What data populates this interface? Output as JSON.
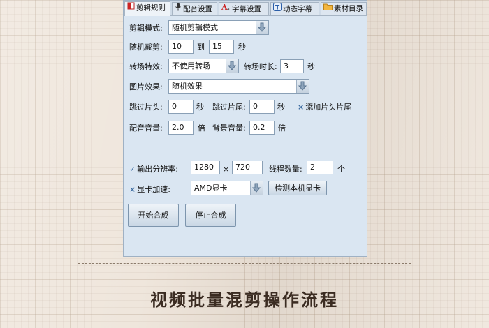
{
  "tabs": [
    {
      "label": "剪辑规则",
      "icon": "red-book-icon"
    },
    {
      "label": "配音设置",
      "icon": "microphone-icon"
    },
    {
      "label": "字幕设置",
      "icon": "text-a-icon"
    },
    {
      "label": "动态字幕",
      "icon": "t-box-icon"
    },
    {
      "label": "素材目录",
      "icon": "folder-icon"
    }
  ],
  "form": {
    "mode_label": "剪辑模式:",
    "mode_value": "随机剪辑模式",
    "random_cut_label": "随机截剪:",
    "random_from": "10",
    "to_label": "到",
    "random_to": "15",
    "sec_label": "秒",
    "transition_label": "转场特效:",
    "transition_value": "不使用转场",
    "transition_dur_label": "转场时长:",
    "transition_dur_value": "3",
    "image_effect_label": "图片效果:",
    "image_effect_value": "随机效果",
    "skip_head_label": "跳过片头:",
    "skip_head_value": "0",
    "skip_tail_label": "跳过片尾:",
    "skip_tail_value": "0",
    "add_head_tail_label": "添加片头片尾",
    "dub_volume_label": "配音音量:",
    "dub_volume_value": "2.0",
    "times_label": "倍",
    "bg_volume_label": "背景音量:",
    "bg_volume_value": "0.2",
    "resolution_label": "输出分辨率:",
    "res_width": "1280",
    "x_label": "×",
    "res_height": "720",
    "threads_label": "线程数量:",
    "threads_value": "2",
    "threads_unit": "个",
    "gpu_label": "显卡加速:",
    "gpu_value": "AMD显卡",
    "detect_gpu_label": "检测本机显卡"
  },
  "buttons": {
    "start": "开始合成",
    "stop": "停止合成"
  },
  "page_title": "视频批量混剪操作流程",
  "colors": {
    "window_bg": "#dae6f2",
    "page_bg": "#efe6dc",
    "title_text": "#3b2c22"
  }
}
